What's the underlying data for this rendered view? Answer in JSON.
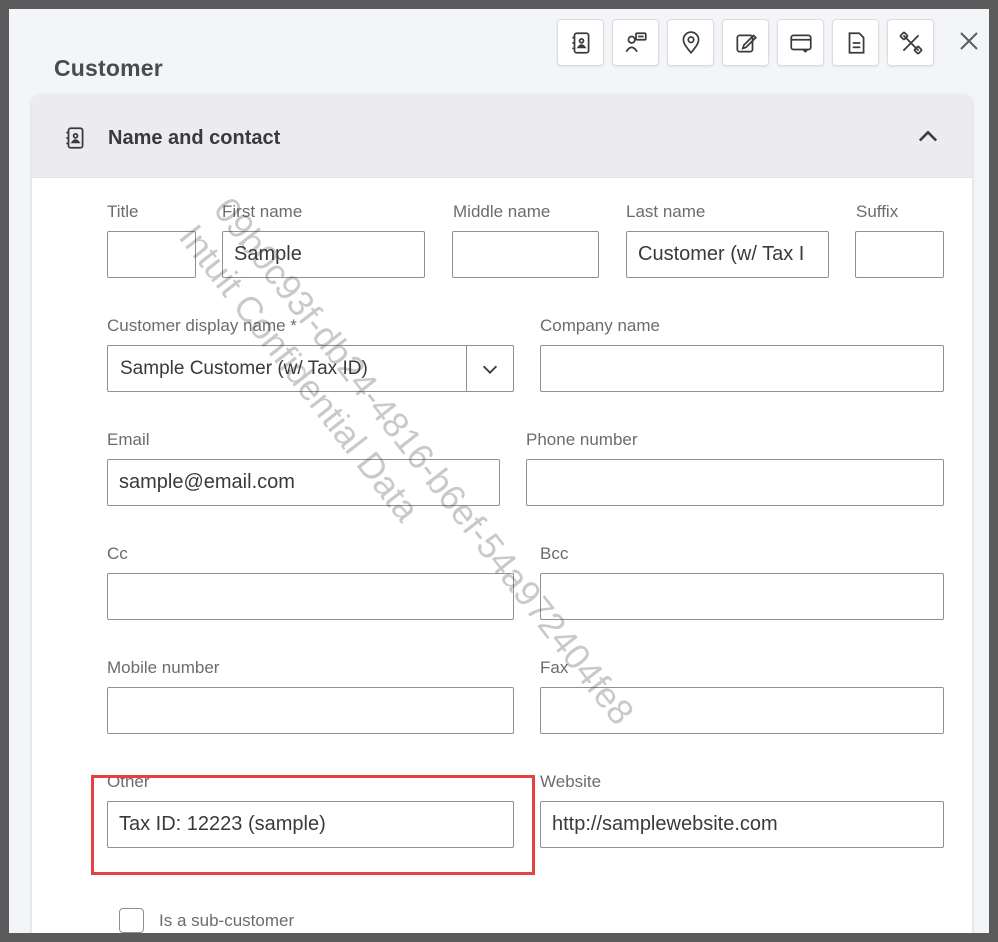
{
  "header": {
    "title": "Customer",
    "toolbar_icons": [
      "contact-card-icon",
      "person-chat-icon",
      "location-pin-icon",
      "edit-note-icon",
      "payment-card-icon",
      "document-icon",
      "tools-icon"
    ],
    "close_icon": "close-icon"
  },
  "section": {
    "title": "Name and contact",
    "icon": "contact-card-icon",
    "collapse_icon": "chevron-up-icon"
  },
  "fields": {
    "title_label": "Title",
    "title_value": "",
    "first_name_label": "First name",
    "first_name_value": "Sample",
    "middle_name_label": "Middle name",
    "middle_name_value": "",
    "last_name_label": "Last name",
    "last_name_value": "Customer (w/ Tax I",
    "suffix_label": "Suffix",
    "suffix_value": "",
    "display_name_label": "Customer display name *",
    "display_name_value": "Sample Customer (w/ Tax ID)",
    "company_name_label": "Company name",
    "company_name_value": "",
    "email_label": "Email",
    "email_value": "sample@email.com",
    "phone_label": "Phone number",
    "phone_value": "",
    "cc_label": "Cc",
    "cc_value": "",
    "bcc_label": "Bcc",
    "bcc_value": "",
    "mobile_label": "Mobile number",
    "mobile_value": "",
    "fax_label": "Fax",
    "fax_value": "",
    "other_label": "Other",
    "other_value": "Tax ID: 12223 (sample)",
    "website_label": "Website",
    "website_value": "http://samplewebsite.com",
    "sub_customer_label": "Is a sub-customer"
  },
  "watermark": {
    "line1": "09b0c93f-db24-4816-b6ef-54a972404fe8",
    "line2": "Intuit Confidential Data"
  },
  "colors": {
    "highlight": "#e44242",
    "field_border": "#8d9096",
    "header_bg": "#ececee"
  }
}
